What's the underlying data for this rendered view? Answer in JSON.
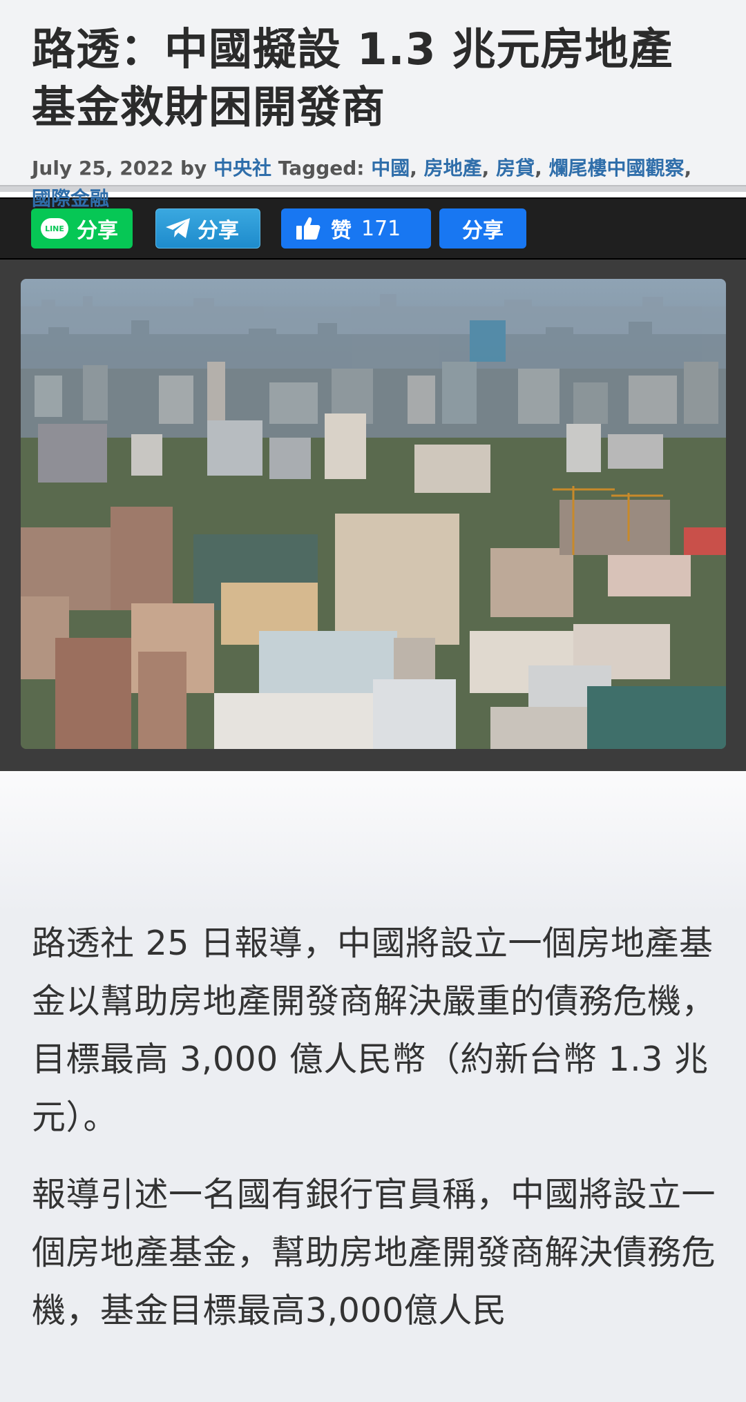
{
  "article": {
    "title": "路透：中國擬設 1.3 兆元房地產基金救財困開發商",
    "meta": {
      "date": "July 25, 2022",
      "by": "by",
      "author": "中央社",
      "tagged_label": "Tagged:",
      "tags": [
        "中國",
        "房地產",
        "房貸",
        "爛尾樓中國觀察",
        "國際金融"
      ]
    },
    "paragraphs": [
      "路透社 25 日報導，中國將設立一個房地產基金以幫助房地產開發商解決嚴重的債務危機，目標最高 3,000 億人民幣（約新台幣 1.3 兆元）。",
      "報導引述一名國有銀行官員稱，中國將設立一個房地產基金，幫助房地產開發商解決債務危機，基金目標最高3,000億人民"
    ]
  },
  "share": {
    "line_badge": "LINE",
    "line_label": "分享",
    "telegram_label": "分享",
    "like_label": "赞",
    "like_count": "171",
    "facebook_share_label": "分享"
  },
  "colors": {
    "line": "#06c755",
    "telegram": "#2a9ad6",
    "facebook": "#1877f2",
    "link": "#2f6eaa"
  }
}
